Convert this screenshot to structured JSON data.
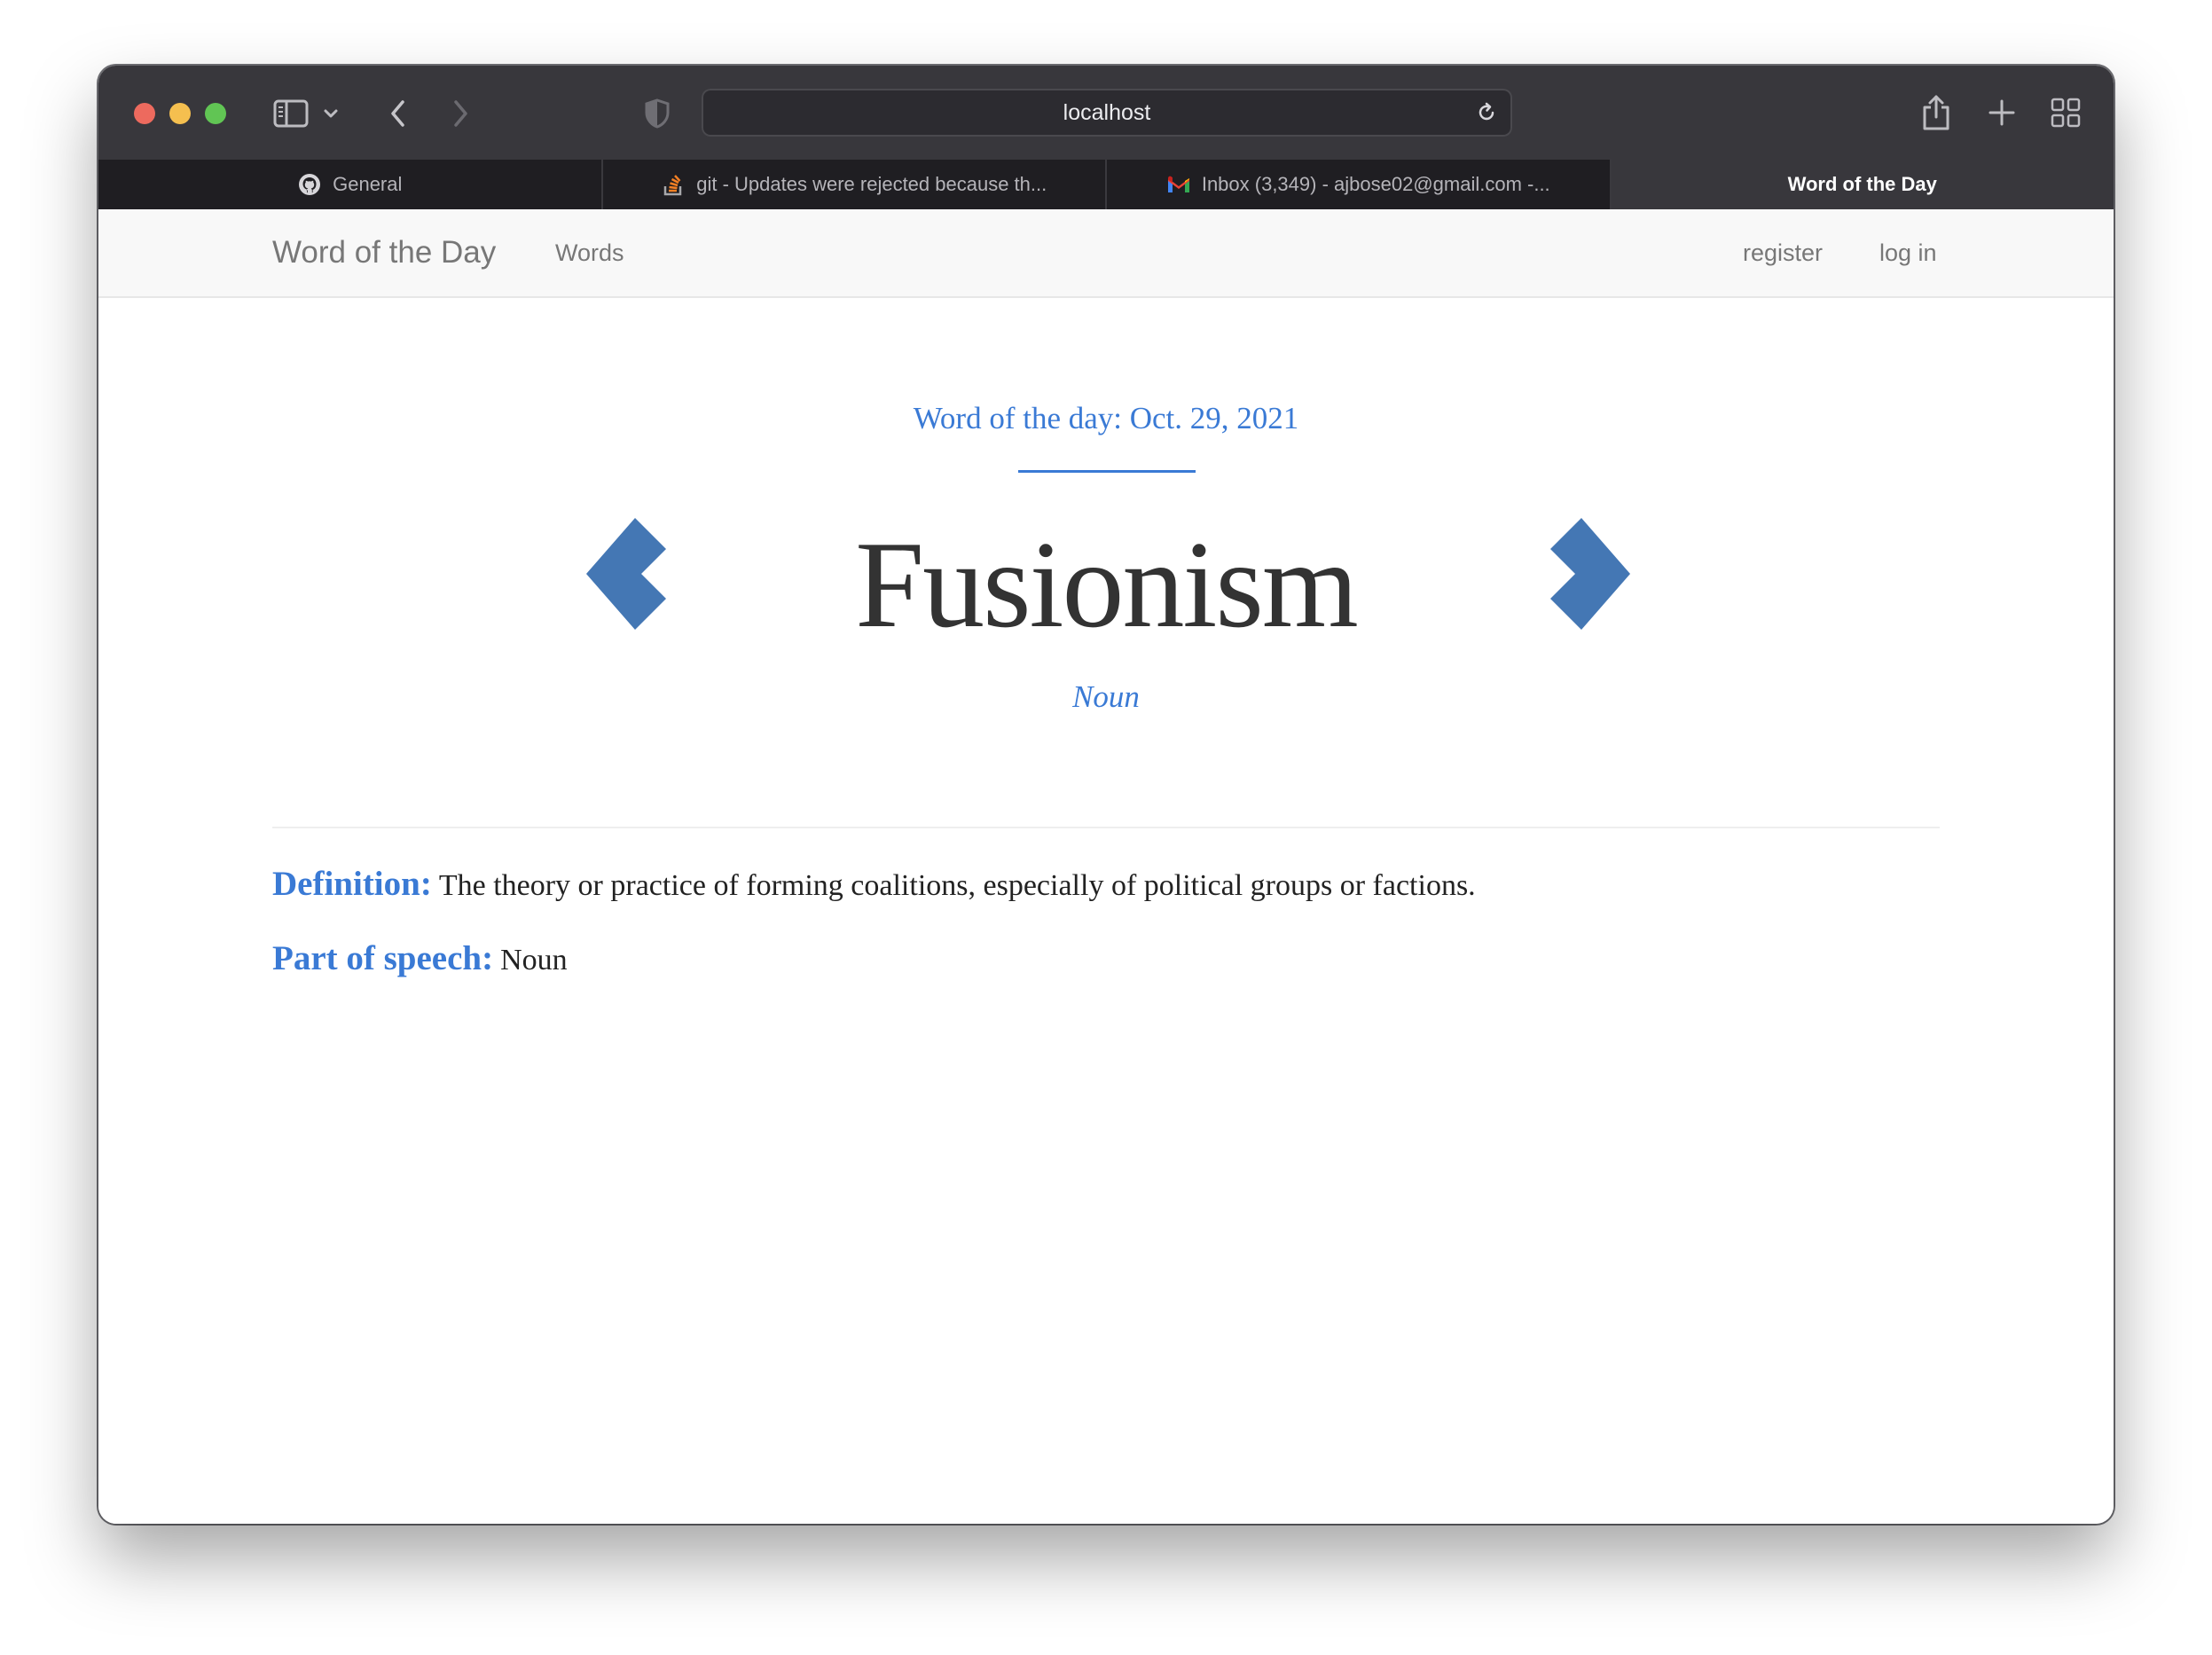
{
  "browser": {
    "address": "localhost",
    "tabs": [
      {
        "label": "General",
        "icon": "github-icon",
        "active": false
      },
      {
        "label": "git - Updates were rejected because th...",
        "icon": "stackoverflow-icon",
        "active": false
      },
      {
        "label": "Inbox (3,349) - ajbose02@gmail.com -...",
        "icon": "gmail-icon",
        "active": false
      },
      {
        "label": "Word of the Day",
        "icon": "",
        "active": true
      }
    ]
  },
  "navbar": {
    "brand": "Word of the Day",
    "links": {
      "words": "Words",
      "register": "register",
      "login": "log in"
    }
  },
  "main": {
    "date_heading": "Word of the day: Oct. 29, 2021",
    "word": "Fusionism",
    "part_of_speech_subtitle": "Noun",
    "definition_label": "Definition:",
    "definition": "The theory or practice of forming coalitions, especially of political groups or factions.",
    "pos_label": "Part of speech:",
    "pos_value": "Noun"
  },
  "colors": {
    "accent": "#3a7ad5",
    "arrow": "#4477b4",
    "toolbar": "#38373c",
    "navbar_bg": "#f8f8f8"
  }
}
